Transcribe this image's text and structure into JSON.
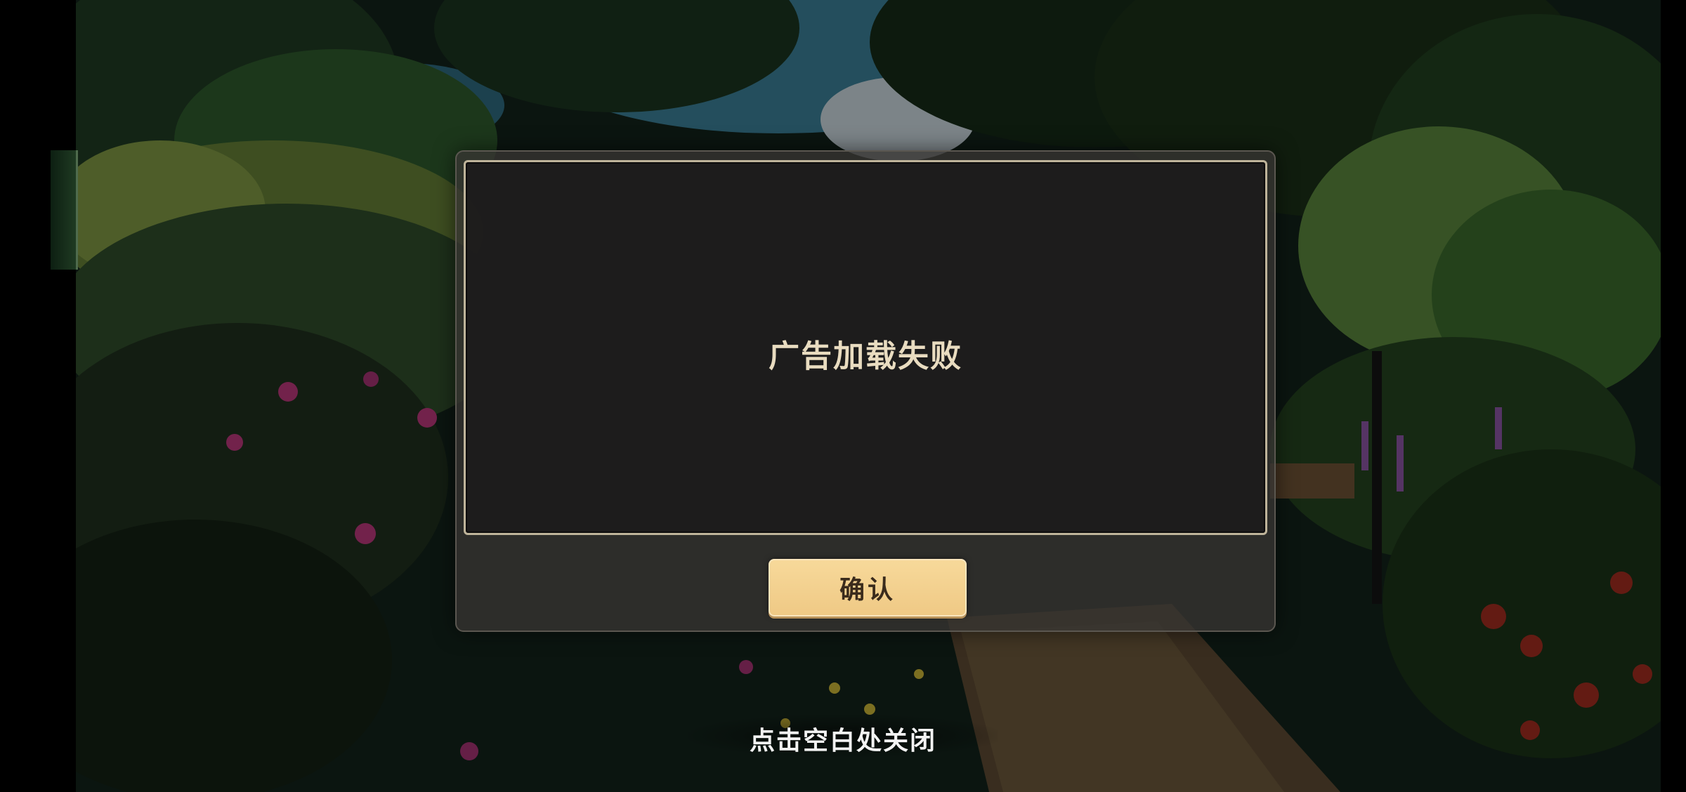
{
  "dialog": {
    "message": "广告加载失败",
    "confirm_label": "确认"
  },
  "hint": {
    "close_text": "点击空白处关闭"
  },
  "colors": {
    "dialog_frame": "#bfb49a",
    "dialog_fill": "#1c1b1b",
    "message_text": "#e9dcc0",
    "button_fill": "#f2cf8c",
    "button_text": "#3a2b1c"
  }
}
